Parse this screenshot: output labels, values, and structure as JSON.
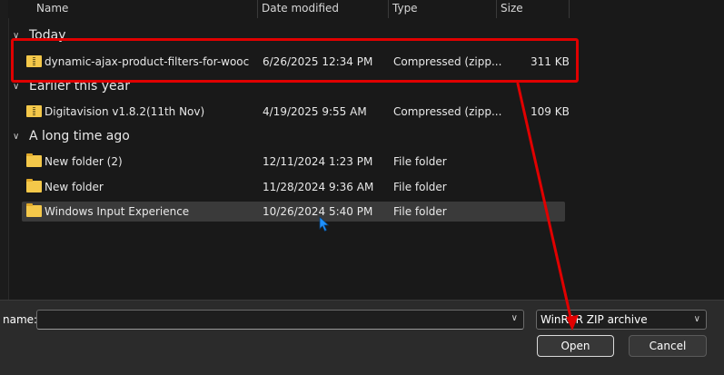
{
  "columns": {
    "name": "Name",
    "date": "Date modified",
    "type": "Type",
    "size": "Size"
  },
  "groups": {
    "today": "Today",
    "earlier": "Earlier this year",
    "long_ago": "A long time ago"
  },
  "files": [
    {
      "name": "dynamic-ajax-product-filters-for-wooco...",
      "date": "6/26/2025 12:34 PM",
      "type": "Compressed (zipp...",
      "size": "311 KB",
      "icon": "zip-icon"
    },
    {
      "name": "Digitavision v1.8.2(11th Nov)",
      "date": "4/19/2025 9:55 AM",
      "type": "Compressed (zipp...",
      "size": "109 KB",
      "icon": "zip-icon"
    },
    {
      "name": "New folder (2)",
      "date": "12/11/2024 1:23 PM",
      "type": "File folder",
      "size": "",
      "icon": "folder-icon"
    },
    {
      "name": "New folder",
      "date": "11/28/2024 9:36 AM",
      "type": "File folder",
      "size": "",
      "icon": "folder-icon"
    },
    {
      "name": "Windows Input Experience",
      "date": "10/26/2024 5:40 PM",
      "type": "File folder",
      "size": "",
      "icon": "folder-icon"
    }
  ],
  "footer": {
    "name_label": "name:",
    "name_value": "",
    "file_type": "WinRAR ZIP archive",
    "open_label": "Open",
    "cancel_label": "Cancel"
  },
  "colors": {
    "annotation": "#e00000",
    "folder": "#f4c84a",
    "selection": "#3a3a3a"
  }
}
